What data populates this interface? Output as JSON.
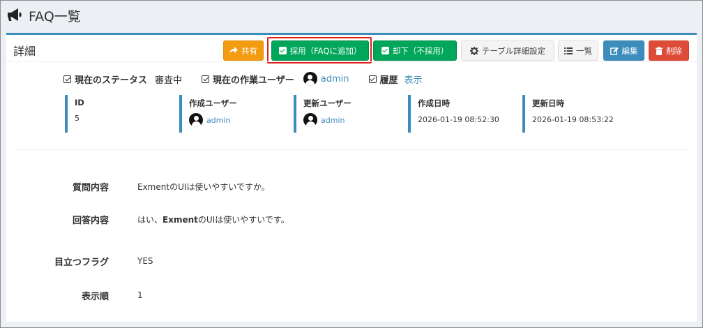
{
  "page": {
    "title": "FAQ一覧",
    "header_icon": "bullhorn-icon"
  },
  "box": {
    "title": "詳細"
  },
  "toolbar": {
    "share": {
      "label": "共有",
      "icon": "share-icon",
      "color": "#f39c12"
    },
    "adopt": {
      "label": "採用（FAQに追加）",
      "icon": "check-square-icon",
      "color": "#00a65a"
    },
    "reject": {
      "label": "却下（不採用）",
      "icon": "check-square-icon",
      "color": "#00a65a"
    },
    "table_settings": {
      "label": "テーブル詳細設定",
      "icon": "gear-icon"
    },
    "list": {
      "label": "一覧",
      "icon": "list-icon"
    },
    "edit": {
      "label": "編集",
      "icon": "edit-icon",
      "color": "#3c8dbc"
    },
    "delete": {
      "label": "削除",
      "icon": "trash-icon",
      "color": "#dd4b39"
    }
  },
  "status": {
    "current_status_label": "現在のステータス",
    "current_status_value": "審査中",
    "current_user_label": "現在の作業ユーザー",
    "current_user_value": "admin",
    "history_label": "履歴",
    "history_link": "表示"
  },
  "info": {
    "id_label": "ID",
    "id_value": "5",
    "created_user_label": "作成ユーザー",
    "created_user_value": "admin",
    "updated_user_label": "更新ユーザー",
    "updated_user_value": "admin",
    "created_at_label": "作成日時",
    "created_at_value": "2026-01-19 08:52:30",
    "updated_at_label": "更新日時",
    "updated_at_value": "2026-01-19 08:53:22"
  },
  "fields": {
    "question_label": "質問内容",
    "question_value": "ExmentのUIは使いやすいですか。",
    "answer_label": "回答内容",
    "answer_prefix": "はい、",
    "answer_bold": "Exment",
    "answer_suffix": "のUIは使いやすいです。",
    "flag_label": "目立つフラグ",
    "flag_value": "YES",
    "order_label": "表示順",
    "order_value": "1"
  }
}
